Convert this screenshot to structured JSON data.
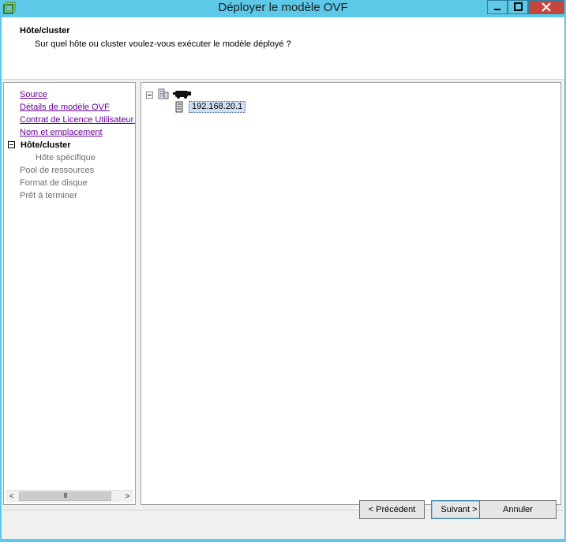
{
  "window": {
    "title": "Déployer le modèle OVF"
  },
  "header": {
    "title": "Hôte/cluster",
    "subtitle": "Sur quel hôte ou cluster voulez-vous exécuter le modèle déployé ?"
  },
  "nav": {
    "items": [
      {
        "label": "Source",
        "state": "link"
      },
      {
        "label": "Détails de modèle OVF",
        "state": "link"
      },
      {
        "label": "Contrat de Licence Utilisateur F",
        "state": "link"
      },
      {
        "label": "Nom et emplacement",
        "state": "link"
      },
      {
        "label": "Hôte/cluster",
        "state": "current"
      },
      {
        "label": "Hôte spécifique",
        "state": "sub"
      },
      {
        "label": "Pool de ressources",
        "state": "disabled"
      },
      {
        "label": "Format de disque",
        "state": "disabled"
      },
      {
        "label": "Prêt à terminer",
        "state": "disabled"
      }
    ],
    "scroll_left": "<",
    "scroll_right": ">",
    "scroll_thumb": "III"
  },
  "tree": {
    "host_label": "192.168.20.1"
  },
  "buttons": {
    "back": "< Précédent",
    "next": "Suivant >",
    "cancel": "Annuler"
  },
  "colors": {
    "titlebar": "#5ec8e8",
    "link": "#660099",
    "selection": "#cfe0f3",
    "close": "#c7463c"
  }
}
